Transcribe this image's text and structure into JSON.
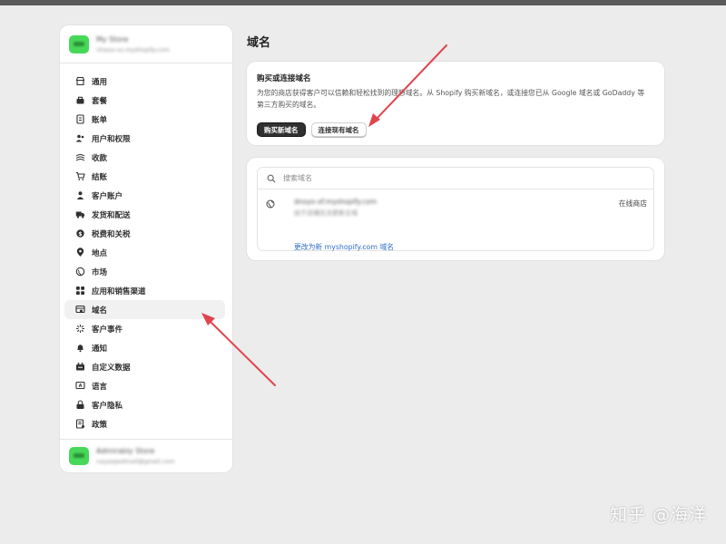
{
  "sidebar": {
    "store": {
      "name": "My Store",
      "url": "nhaxa-xx.myshopify.com"
    },
    "items": [
      {
        "label": "通用",
        "icon": "store-icon"
      },
      {
        "label": "套餐",
        "icon": "plan-icon"
      },
      {
        "label": "账单",
        "icon": "billing-icon"
      },
      {
        "label": "用户和权限",
        "icon": "users-icon"
      },
      {
        "label": "收款",
        "icon": "payments-icon"
      },
      {
        "label": "结账",
        "icon": "cart-icon"
      },
      {
        "label": "客户账户",
        "icon": "person-icon"
      },
      {
        "label": "发货和配送",
        "icon": "truck-icon"
      },
      {
        "label": "税费和关税",
        "icon": "tax-icon"
      },
      {
        "label": "地点",
        "icon": "location-icon"
      },
      {
        "label": "市场",
        "icon": "globe-icon"
      },
      {
        "label": "应用和销售渠道",
        "icon": "apps-icon"
      },
      {
        "label": "域名",
        "icon": "domain-icon",
        "active": true
      },
      {
        "label": "客户事件",
        "icon": "events-icon"
      },
      {
        "label": "通知",
        "icon": "bell-icon"
      },
      {
        "label": "自定义数据",
        "icon": "data-icon"
      },
      {
        "label": "语言",
        "icon": "language-icon"
      },
      {
        "label": "客户隐私",
        "icon": "lock-icon"
      },
      {
        "label": "政策",
        "icon": "policy-icon"
      }
    ],
    "footer": {
      "name": "Admirably Store",
      "email": "nayaxpedmail@gmail.com"
    }
  },
  "page": {
    "title": "域名"
  },
  "buy_card": {
    "title": "购买或连接域名",
    "description": "为您的商店获得客户可以信赖和轻松找到的理想域名。从 Shopify 购买新域名，或连接您已从 Google 域名或 GoDaddy 等第三方购买的域名。",
    "buy_label": "购买新域名",
    "connect_label": "连接现有域名"
  },
  "domains_card": {
    "search_placeholder": "搜索域名",
    "domain": {
      "name": "dnoyo-xf.myshopify.com",
      "subtitle": "由于店铺无法更新主域",
      "status": "在线商店",
      "change_link": "更改为新 myshopify.com 域名"
    }
  },
  "watermark": "知乎 @海洋",
  "colors": {
    "accent_arrow": "#e0454f",
    "link": "#2c6ecb",
    "avatar": "#47d85a"
  }
}
